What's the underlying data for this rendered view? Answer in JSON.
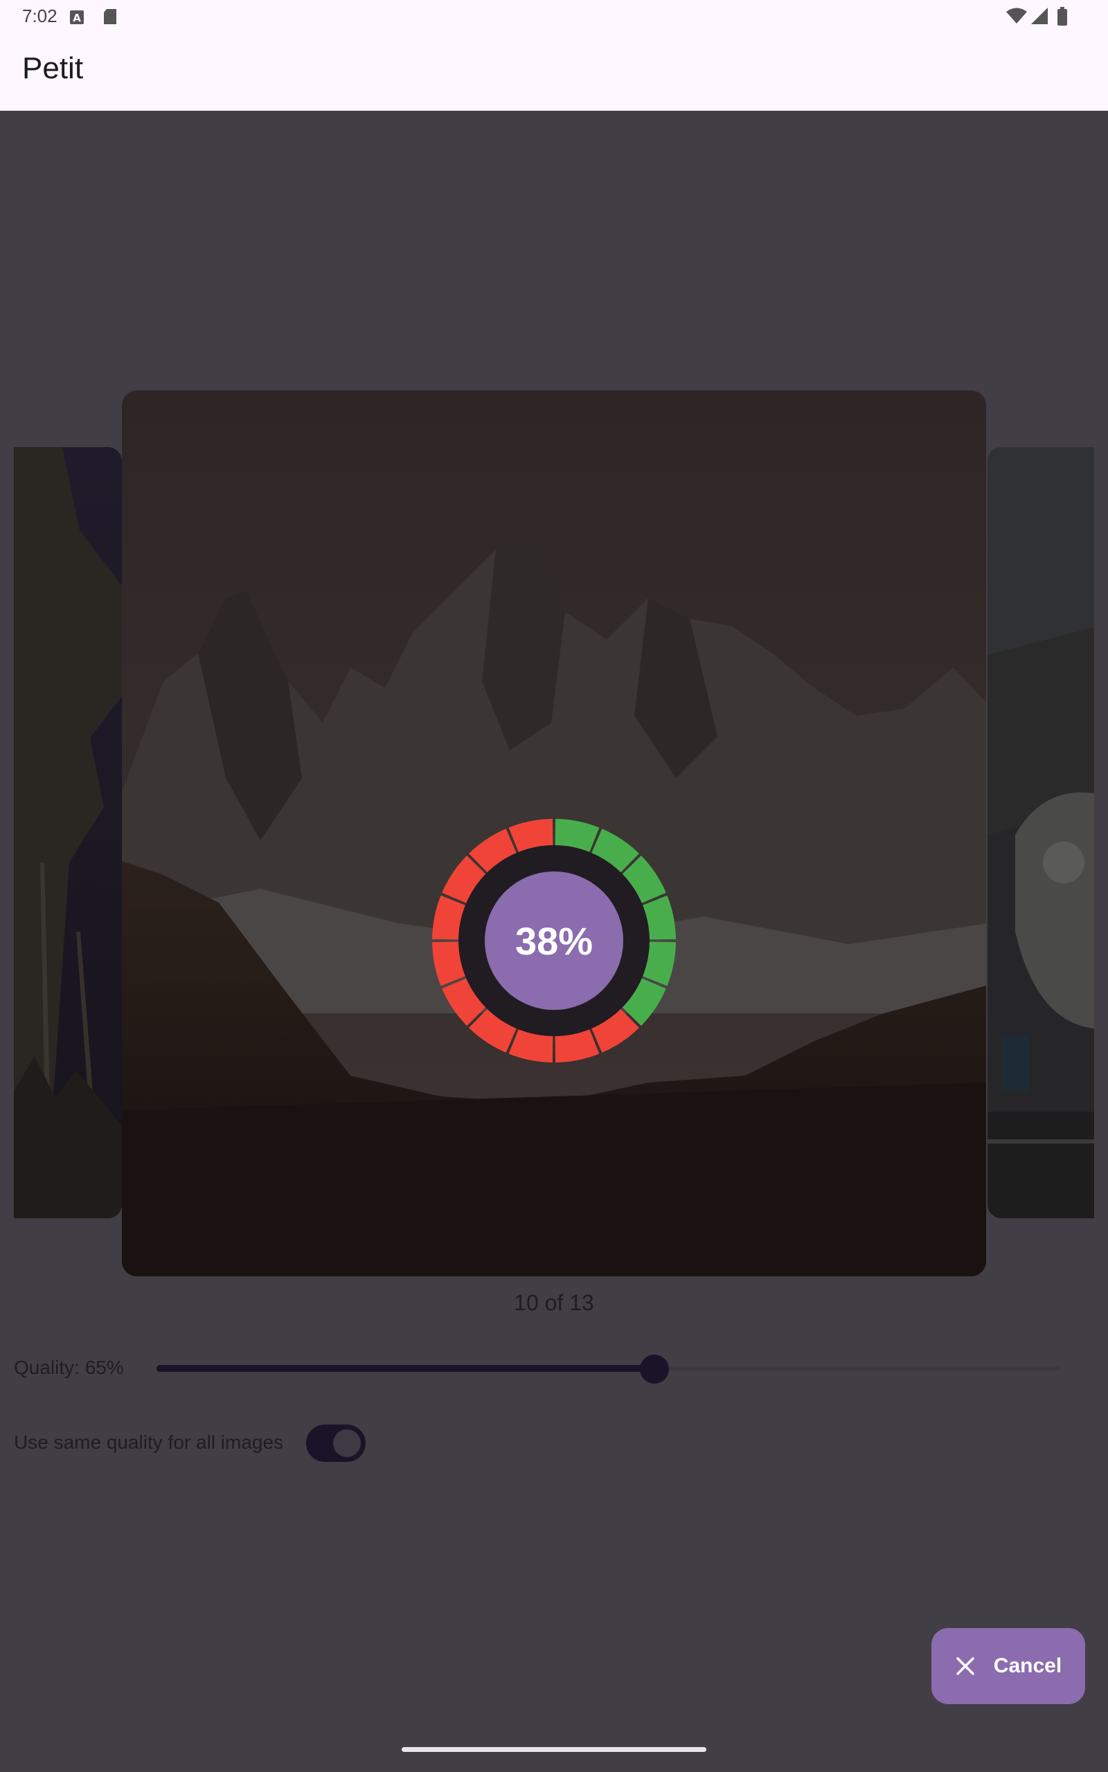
{
  "status_bar": {
    "time": "7:02"
  },
  "app_bar": {
    "title": "Petit"
  },
  "carousel": {
    "counter": "10 of 13"
  },
  "progress": {
    "label": "38%",
    "value": 0.38,
    "segments_total": 16,
    "colors": {
      "done": "#48ae4c",
      "remaining": "#f04438",
      "center": "#8b6cae"
    }
  },
  "quality": {
    "label": "Quality: 65%",
    "value": 0.65
  },
  "same_quality": {
    "label": "Use same quality for all images",
    "enabled": true
  },
  "fab": {
    "label": "Cancel",
    "icon": "close-icon"
  },
  "colors": {
    "scrim": "#413e45",
    "appbar": "#fef7ff",
    "accent": "#8b6cae"
  }
}
